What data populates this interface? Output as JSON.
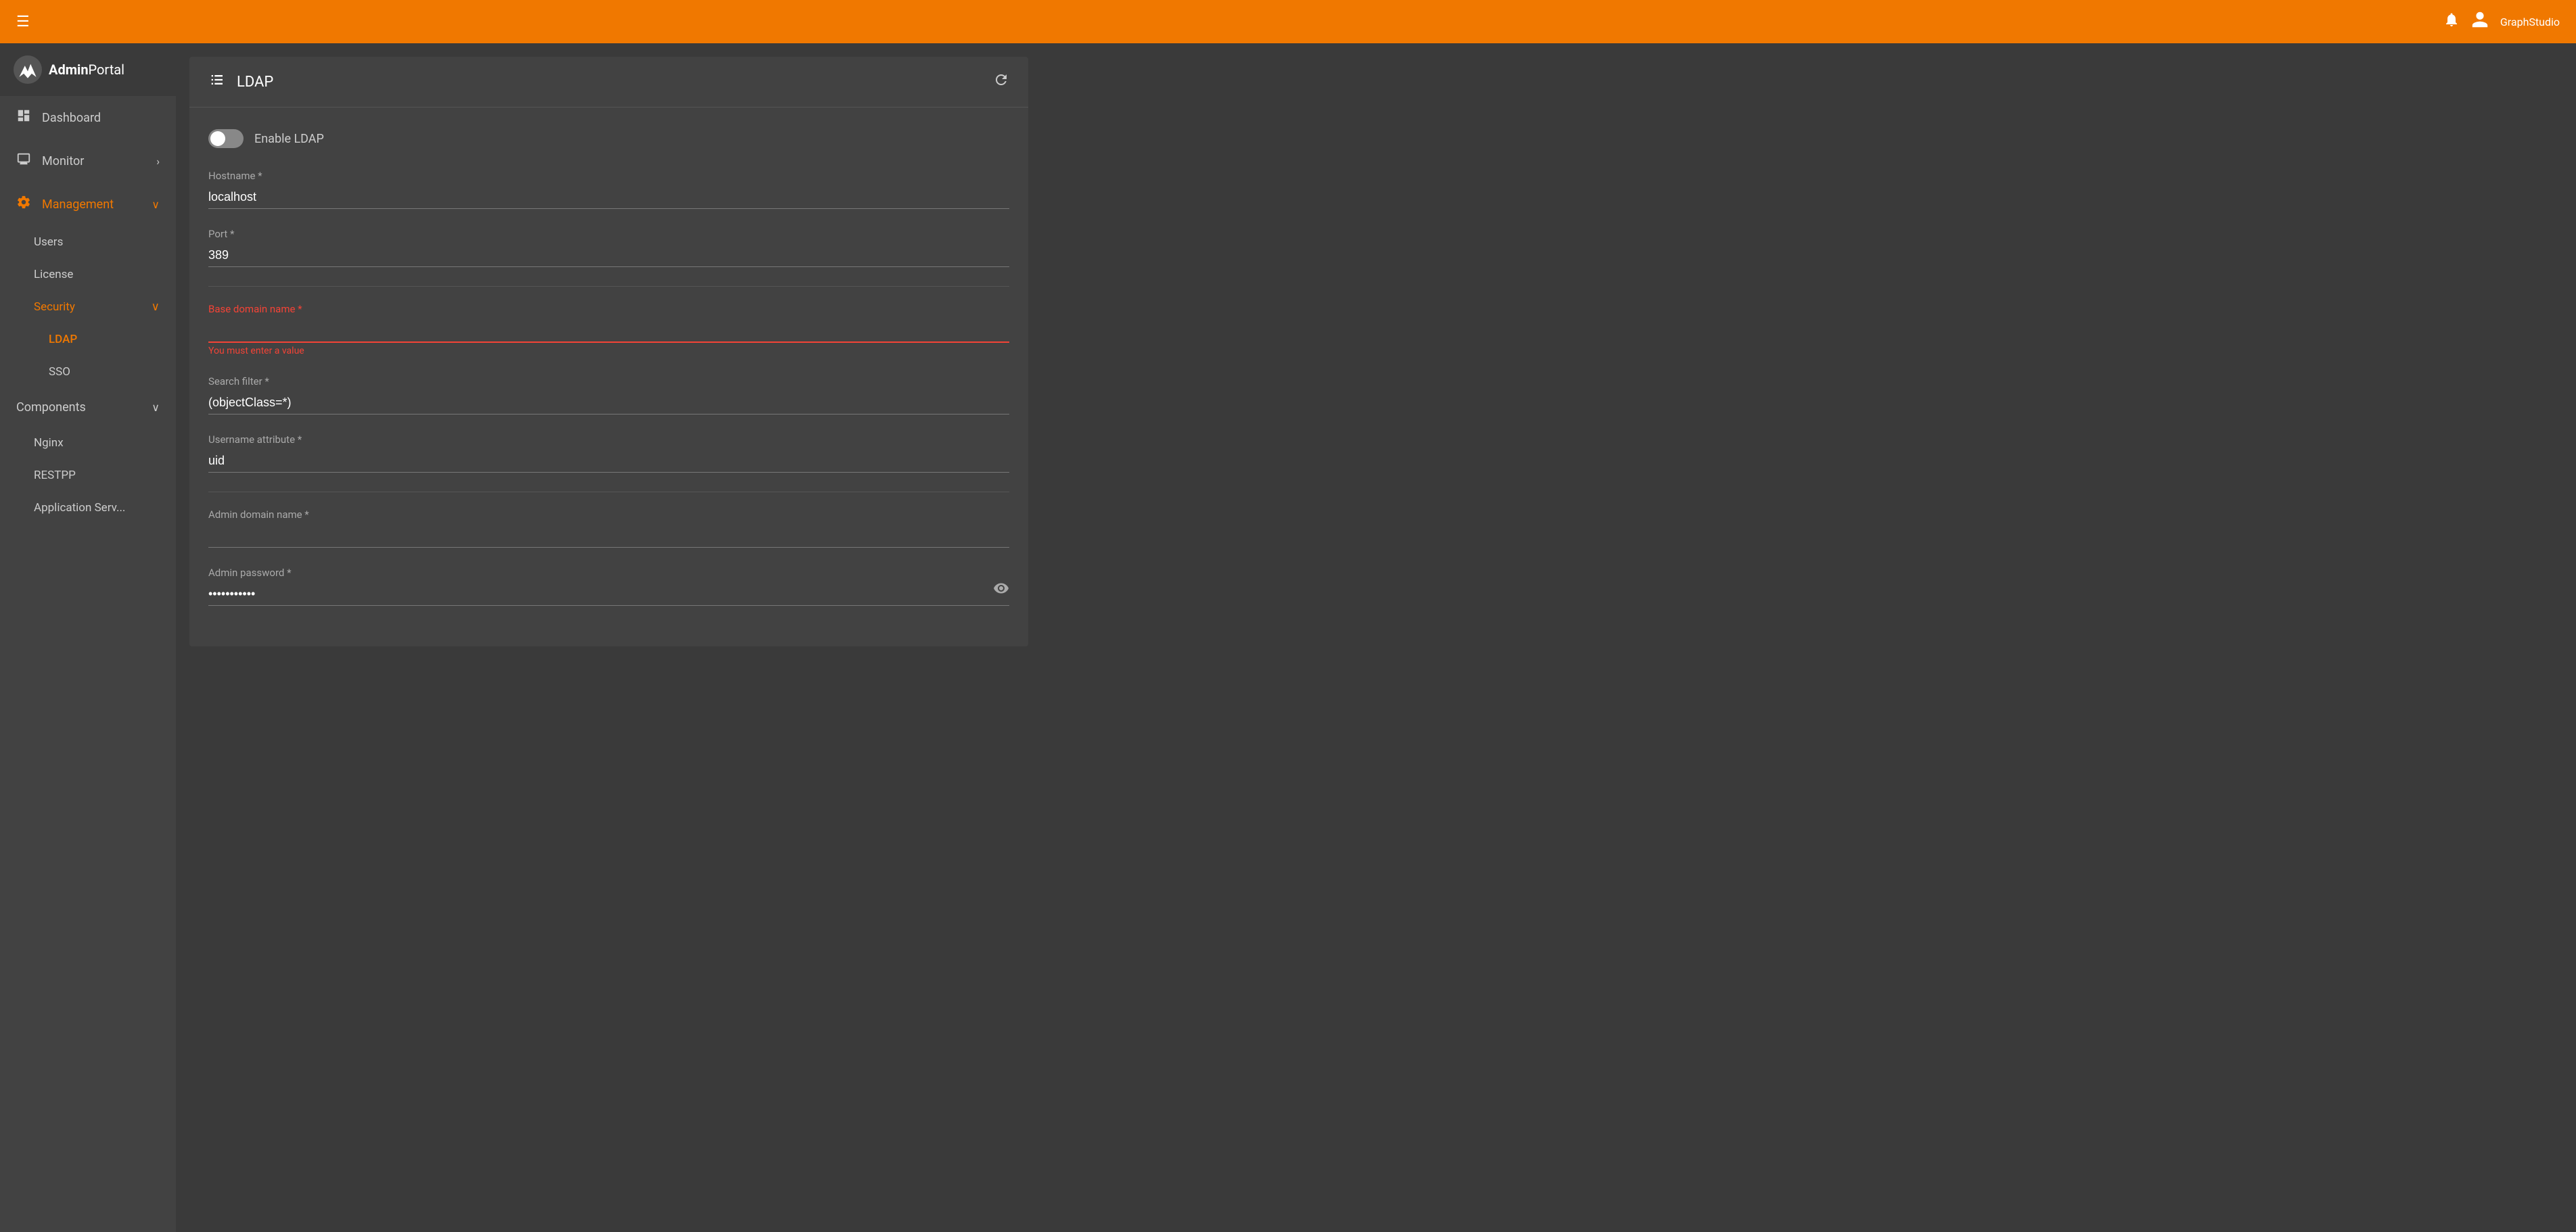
{
  "app": {
    "name_bold": "Admin",
    "name_regular": "Portal",
    "user": "GraphStudio"
  },
  "header": {
    "menu_icon": "☰",
    "bell_icon": "🔔",
    "account_icon": "👤",
    "refresh_icon": "↻"
  },
  "sidebar": {
    "items": [
      {
        "id": "dashboard",
        "label": "Dashboard",
        "icon": "⊞",
        "active": false
      },
      {
        "id": "monitor",
        "label": "Monitor",
        "icon": "🖥",
        "arrow": "›",
        "active": false
      },
      {
        "id": "management",
        "label": "Management",
        "icon": "⚙",
        "arrow": "∨",
        "active": true
      }
    ],
    "management_sub": [
      {
        "id": "users",
        "label": "Users",
        "active": false
      },
      {
        "id": "license",
        "label": "License",
        "active": false
      },
      {
        "id": "security",
        "label": "Security",
        "active": true,
        "arrow": "∨"
      }
    ],
    "security_sub": [
      {
        "id": "ldap",
        "label": "LDAP",
        "active": true
      },
      {
        "id": "sso",
        "label": "SSO",
        "active": false
      }
    ],
    "components": {
      "label": "Components",
      "arrow": "∨",
      "items": [
        {
          "id": "nginx",
          "label": "Nginx"
        },
        {
          "id": "restpp",
          "label": "RESTPP"
        },
        {
          "id": "appserver",
          "label": "Application Serv..."
        }
      ]
    }
  },
  "card": {
    "title": "LDAP",
    "title_icon": "▦"
  },
  "form": {
    "enable_label": "Enable LDAP",
    "enabled": false,
    "hostname_label": "Hostname *",
    "hostname_value": "localhost",
    "port_label": "Port *",
    "port_value": "389",
    "base_domain_label": "Base domain name *",
    "base_domain_value": "",
    "base_domain_error": "You must enter a value",
    "search_filter_label": "Search filter *",
    "search_filter_value": "(objectClass=*)",
    "username_attr_label": "Username attribute *",
    "username_attr_value": "uid",
    "admin_domain_label": "Admin domain name *",
    "admin_domain_value": "",
    "admin_password_label": "Admin password *",
    "admin_password_value": "••••••••"
  }
}
